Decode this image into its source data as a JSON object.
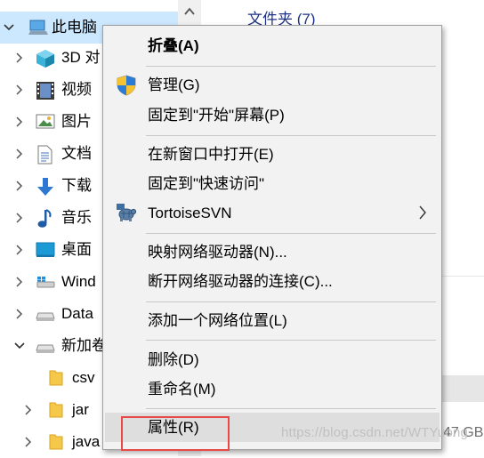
{
  "tree": {
    "items": [
      {
        "label": "此电脑",
        "icon": "computer-icon",
        "expanded": true,
        "selected": true
      },
      {
        "label": "3D 对",
        "icon": "3d-objects-icon"
      },
      {
        "label": "视频",
        "icon": "video-icon"
      },
      {
        "label": "图片",
        "icon": "pictures-icon"
      },
      {
        "label": "文档",
        "icon": "documents-icon"
      },
      {
        "label": "下载",
        "icon": "download-icon"
      },
      {
        "label": "音乐",
        "icon": "music-icon"
      },
      {
        "label": "桌面",
        "icon": "desktop-icon"
      },
      {
        "label": "Wind",
        "icon": "windows-drive-icon"
      },
      {
        "label": "Data",
        "icon": "drive-icon"
      },
      {
        "label": "新加卷",
        "icon": "drive-icon",
        "expanded": true
      },
      {
        "label": "csv",
        "icon": "folder-icon"
      },
      {
        "label": "jar",
        "icon": "folder-icon"
      },
      {
        "label": "java",
        "icon": "folder-icon"
      }
    ]
  },
  "right_pane": {
    "group_header": "文件夹 (7)",
    "drive_size": "47 GB"
  },
  "context_menu": {
    "items": [
      {
        "label": "折叠(A)",
        "bold": true
      },
      {
        "label": "管理(G)",
        "icon": "shield-icon"
      },
      {
        "label": "固定到\"开始\"屏幕(P)"
      },
      {
        "label": "在新窗口中打开(E)"
      },
      {
        "label": "固定到\"快速访问\""
      },
      {
        "label": "TortoiseSVN",
        "icon": "tortoise-icon",
        "submenu": true
      },
      {
        "label": "映射网络驱动器(N)..."
      },
      {
        "label": "断开网络驱动器的连接(C)..."
      },
      {
        "label": "添加一个网络位置(L)"
      },
      {
        "label": "删除(D)"
      },
      {
        "label": "重命名(M)"
      },
      {
        "label": "属性(R)",
        "hovered": true
      }
    ]
  },
  "watermark": "https://blog.csdn.net/WTYuong",
  "colors": {
    "selection": "#cce8ff",
    "menu_bg": "#f2f2f2",
    "menu_hover": "#dedede",
    "highlight_box": "#e84848",
    "group_header": "#1e3287"
  }
}
